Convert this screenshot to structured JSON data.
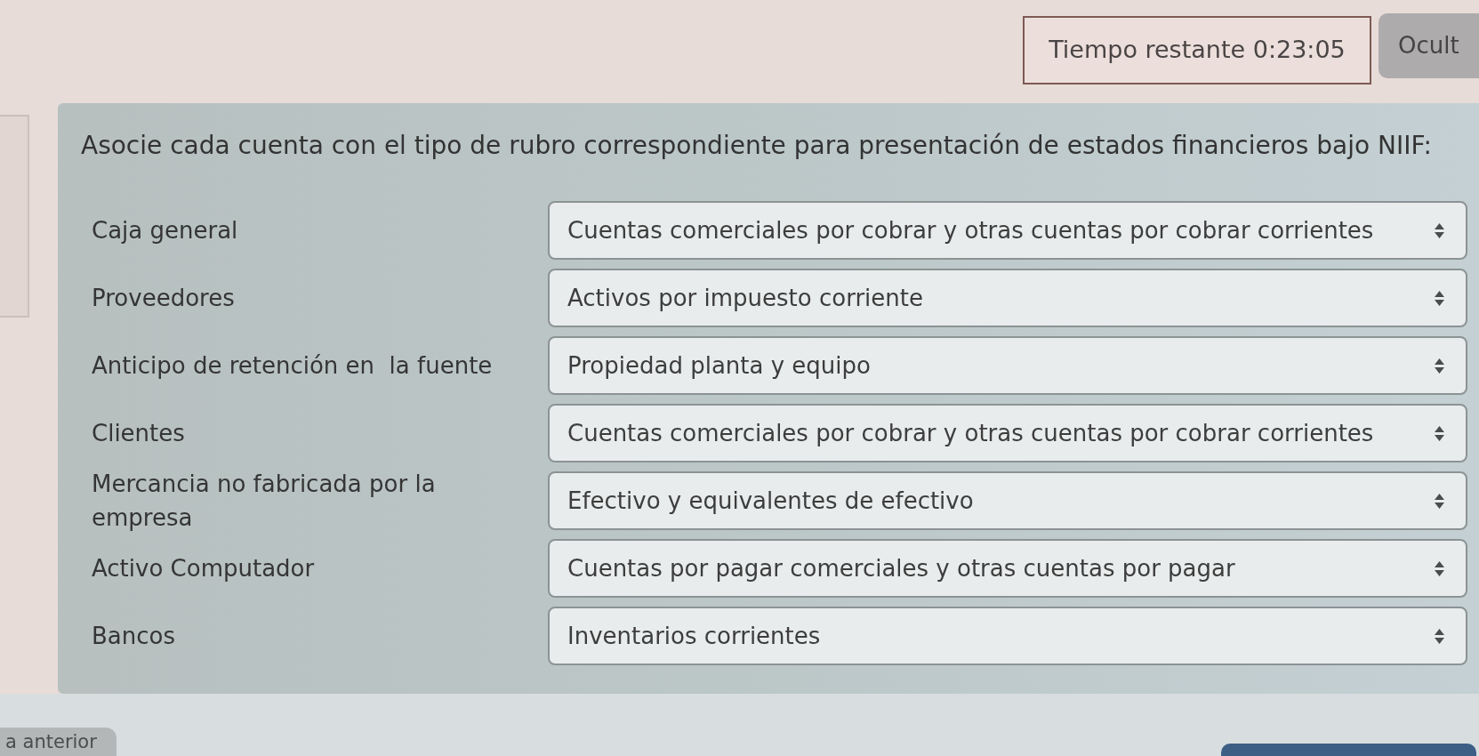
{
  "timer": {
    "text": "Tiempo restante 0:23:05"
  },
  "hide_button": {
    "label": "Ocult"
  },
  "question": {
    "prompt": "Asocie cada cuenta con el tipo de rubro correspondiente para presentación de estados financieros bajo NIIF:",
    "pairs": [
      {
        "account": "Caja general",
        "answer": "Cuentas comerciales por cobrar y otras cuentas por cobrar corrientes"
      },
      {
        "account": "Proveedores",
        "answer": "Activos por impuesto corriente"
      },
      {
        "account": "Anticipo de retención en  la fuente",
        "answer": "Propiedad planta y equipo"
      },
      {
        "account": "Clientes",
        "answer": "Cuentas comerciales por cobrar y otras cuentas por cobrar corrientes"
      },
      {
        "account": "Mercancia no fabricada por la empresa",
        "answer": "Efectivo y equivalentes de efectivo"
      },
      {
        "account": "Activo Computador",
        "answer": "Cuentas por pagar comerciales y otras cuentas por pagar"
      },
      {
        "account": "Bancos",
        "answer": "Inventarios corrientes"
      }
    ]
  },
  "nav_buttons": [
    {
      "kind": "secondary",
      "label": "a anterior"
    },
    {
      "kind": "primary"
    }
  ]
}
